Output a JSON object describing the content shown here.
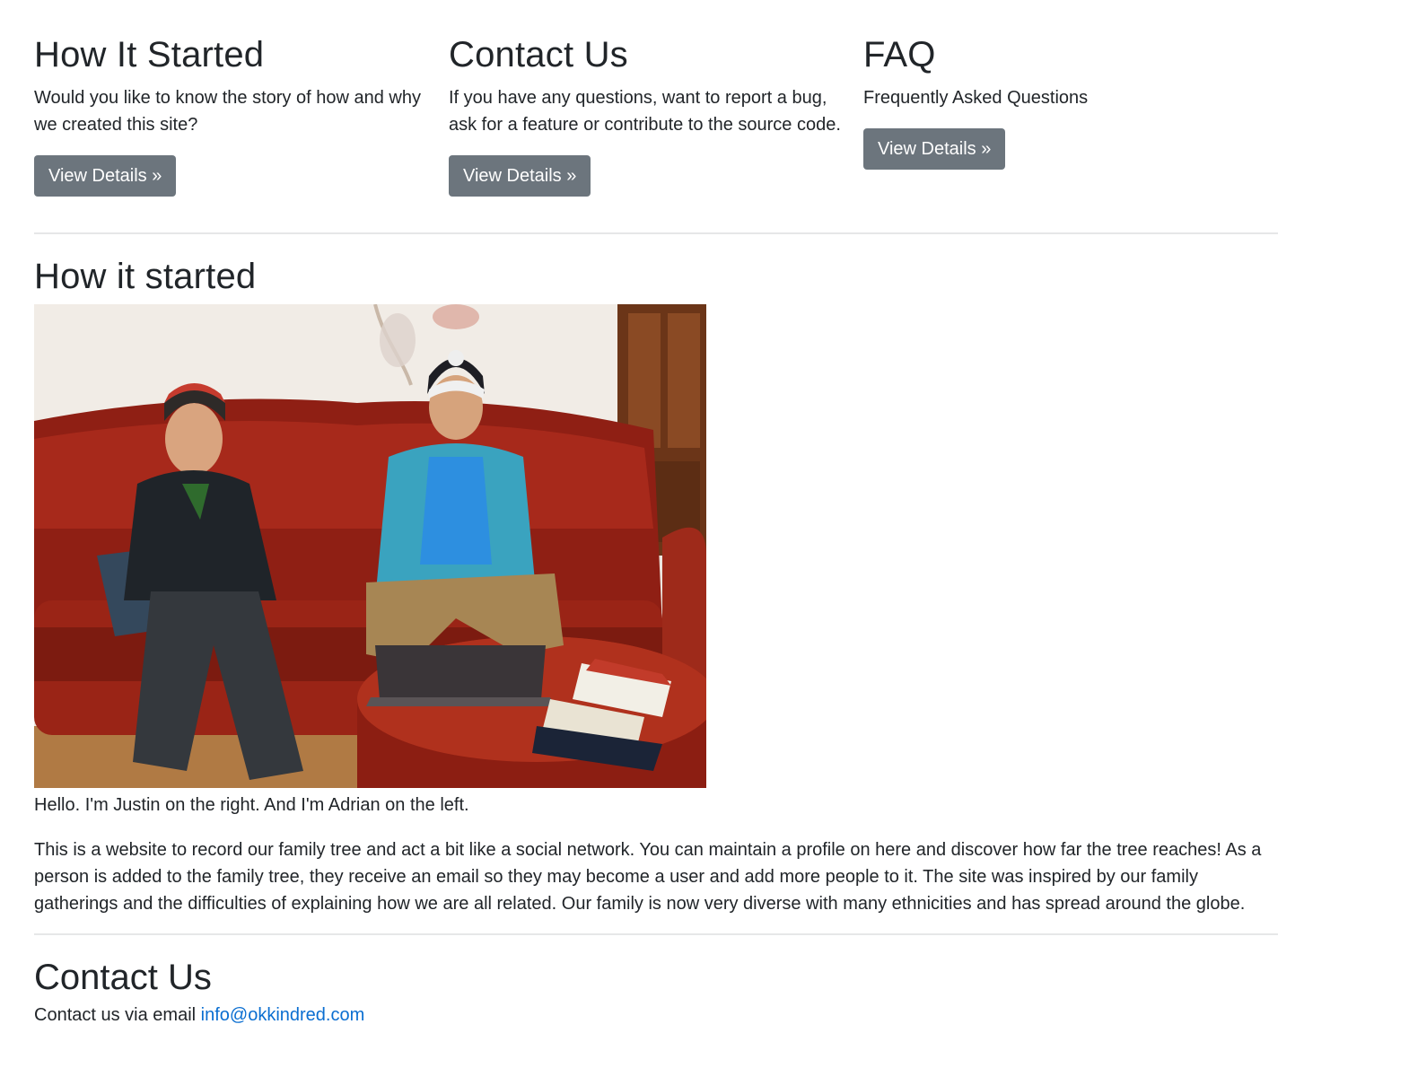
{
  "features": [
    {
      "title": "How It Started",
      "text": "Would you like to know the story of how and why we created this site?",
      "button": "View Details »"
    },
    {
      "title": "Contact Us",
      "text": "If you have any questions, want to report a bug, ask for a feature or contribute to the source code.",
      "button": "View Details »"
    },
    {
      "title": "FAQ",
      "text": "Frequently Asked Questions",
      "button": "View Details »"
    }
  ],
  "story": {
    "title": "How it started",
    "caption": "Hello. I'm Justin on the right. And I'm Adrian on the left.",
    "paragraph": "This is a website to record our family tree and act a bit like a social network. You can maintain a profile on here and discover how far the tree reaches! As a person is added to the family tree, they receive an email so they may become a user and add more people to it. The site was inspired by our family gatherings and the difficulties of explaining how we are all related. Our family is now very diverse with many ethnicities and has spread around the globe."
  },
  "contact": {
    "title": "Contact Us",
    "prefix": "Contact us via email",
    "email": "info@okkindred.com",
    "email_href": "mailto:info@okkindred.com"
  },
  "colors": {
    "button_bg": "#6c757d",
    "link": "#0a6ed1",
    "text": "#212529"
  }
}
